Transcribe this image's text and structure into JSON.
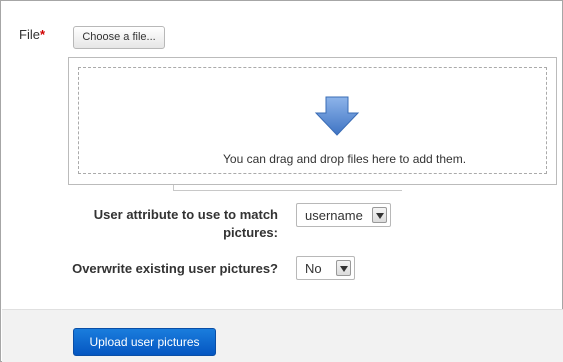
{
  "file": {
    "label": "File",
    "required_mark": "*",
    "choose_button": "Choose a file...",
    "dropzone_text": "You can drag and drop files here to add them."
  },
  "user_attribute": {
    "label_line1": "User attribute to use to match",
    "label_line2": "pictures:",
    "selected": "username"
  },
  "overwrite": {
    "label": "Overwrite existing user pictures?",
    "selected": "No"
  },
  "footer": {
    "upload_button": "Upload user pictures"
  },
  "colors": {
    "required": "#d00000",
    "primary_button": "#0a66cc",
    "drop_arrow": "#5b8fd6"
  },
  "icons": {
    "drop_arrow": "arrow-down-icon",
    "select_arrow": "chevron-down-icon"
  }
}
